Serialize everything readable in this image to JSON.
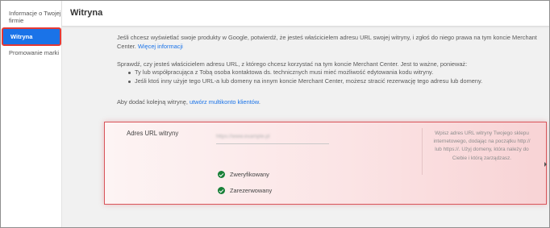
{
  "sidebar": {
    "items": [
      {
        "label": "Informacje o Twojej firmie"
      },
      {
        "label": "Witryna"
      },
      {
        "label": "Promowanie marki"
      }
    ]
  },
  "header": {
    "title": "Witryna"
  },
  "main": {
    "intro": "Jeśli chcesz wyświetlać swoje produkty w Google, potwierdź, że jesteś właścicielem adresu URL swojej witryny, i zgłoś do niego prawa na tym koncie Merchant Center.",
    "more_info_link": "Więcej informacji",
    "check_intro": "Sprawdź, czy jesteś właścicielem adresu URL, z którego chcesz korzystać na tym koncie Merchant Center. Jest to ważne, ponieważ:",
    "bullets": [
      "Ty lub współpracująca z Tobą osoba kontaktowa ds. technicznych musi mieć możliwość edytowania kodu witryny.",
      "Jeśli ktoś inny użyje tego URL-a lub domeny na innym koncie Merchant Center, możesz stracić rezerwację tego adresu lub domeny."
    ],
    "add_site_text": "Aby dodać kolejną witrynę,",
    "multiaccount_link": "utwórz multikonto klientów",
    "add_site_suffix": "."
  },
  "url_card": {
    "label": "Adres URL witryny",
    "url_value": "https://www.example.pl",
    "help_text": "Wpisz adres URL witryny Twojego sklepu internetowego, dodając na początku http:// lub https://. Użyj domeny, która należy do Ciebie i którą zarządzasz.",
    "status_verified": "Zweryfikowany",
    "status_reserved": "Zarezerwowany",
    "status_icon": "check-circle-icon",
    "status_color": "#188038",
    "highlight_color": "#d9545a"
  },
  "colors": {
    "accent": "#1a73e8",
    "highlight_border": "#e53935"
  }
}
